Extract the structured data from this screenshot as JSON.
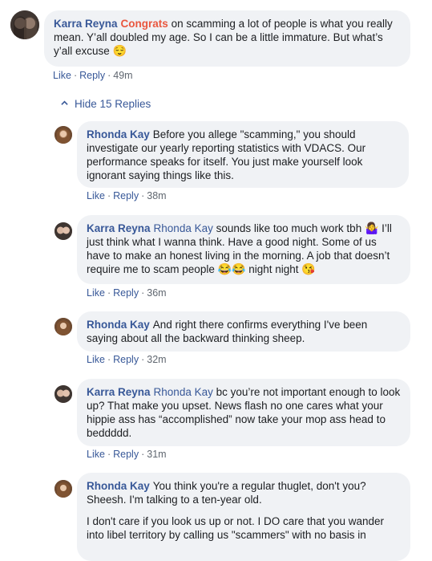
{
  "comments": [
    {
      "author": "Karra Reyna",
      "segments": [
        {
          "text": "Congrats",
          "style": "highlight"
        },
        {
          "text": " on scamming a lot of people is what you really mean. Y’all doubled my age. So I can be a little immature. But what’s y’all excuse ",
          "style": "plain"
        },
        {
          "text": "😌",
          "style": "emoji"
        }
      ],
      "like": "Like",
      "reply": "Reply",
      "time": "49m"
    }
  ],
  "hide_replies_label": "Hide 15 Replies",
  "replies": [
    {
      "author": "Rhonda Kay",
      "text": "Before you allege \"scamming,\" you should investigate our yearly reporting statistics with VDACS. Our performance speaks for itself. You just make yourself look ignorant saying things like this.",
      "like": "Like",
      "reply": "Reply",
      "time": "38m"
    },
    {
      "author": "Karra Reyna",
      "mention": "Rhonda Kay",
      "text": " sounds like too much work tbh ",
      "emoji1": "🤷‍♀️",
      "text2": " I’ll just think what I wanna think. Have a good night. Some of us have to make an honest living in the morning. A job that doesn’t require me to scam people ",
      "emoji2": "😂😂",
      "text3": " night night ",
      "emoji3": "😘",
      "like": "Like",
      "reply": "Reply",
      "time": "36m"
    },
    {
      "author": "Rhonda Kay",
      "text": "And right there confirms everything I've been saying about all the backward thinking sheep.",
      "like": "Like",
      "reply": "Reply",
      "time": "32m"
    },
    {
      "author": "Karra Reyna",
      "mention": "Rhonda Kay",
      "text": " bc you’re not important enough to look up? That make you upset. News flash no one cares what your hippie ass has “accomplished” now take your mop ass head to beddddd.",
      "like": "Like",
      "reply": "Reply",
      "time": "31m"
    },
    {
      "author": "Rhonda Kay",
      "text": "You think you're a regular thuglet, don't you? Sheesh. I'm talking to a ten-year old.",
      "text2": "I don't care if you look us up or not. I DO care that you wander into libel territory by calling us \"scammers\" with no basis in"
    }
  ]
}
